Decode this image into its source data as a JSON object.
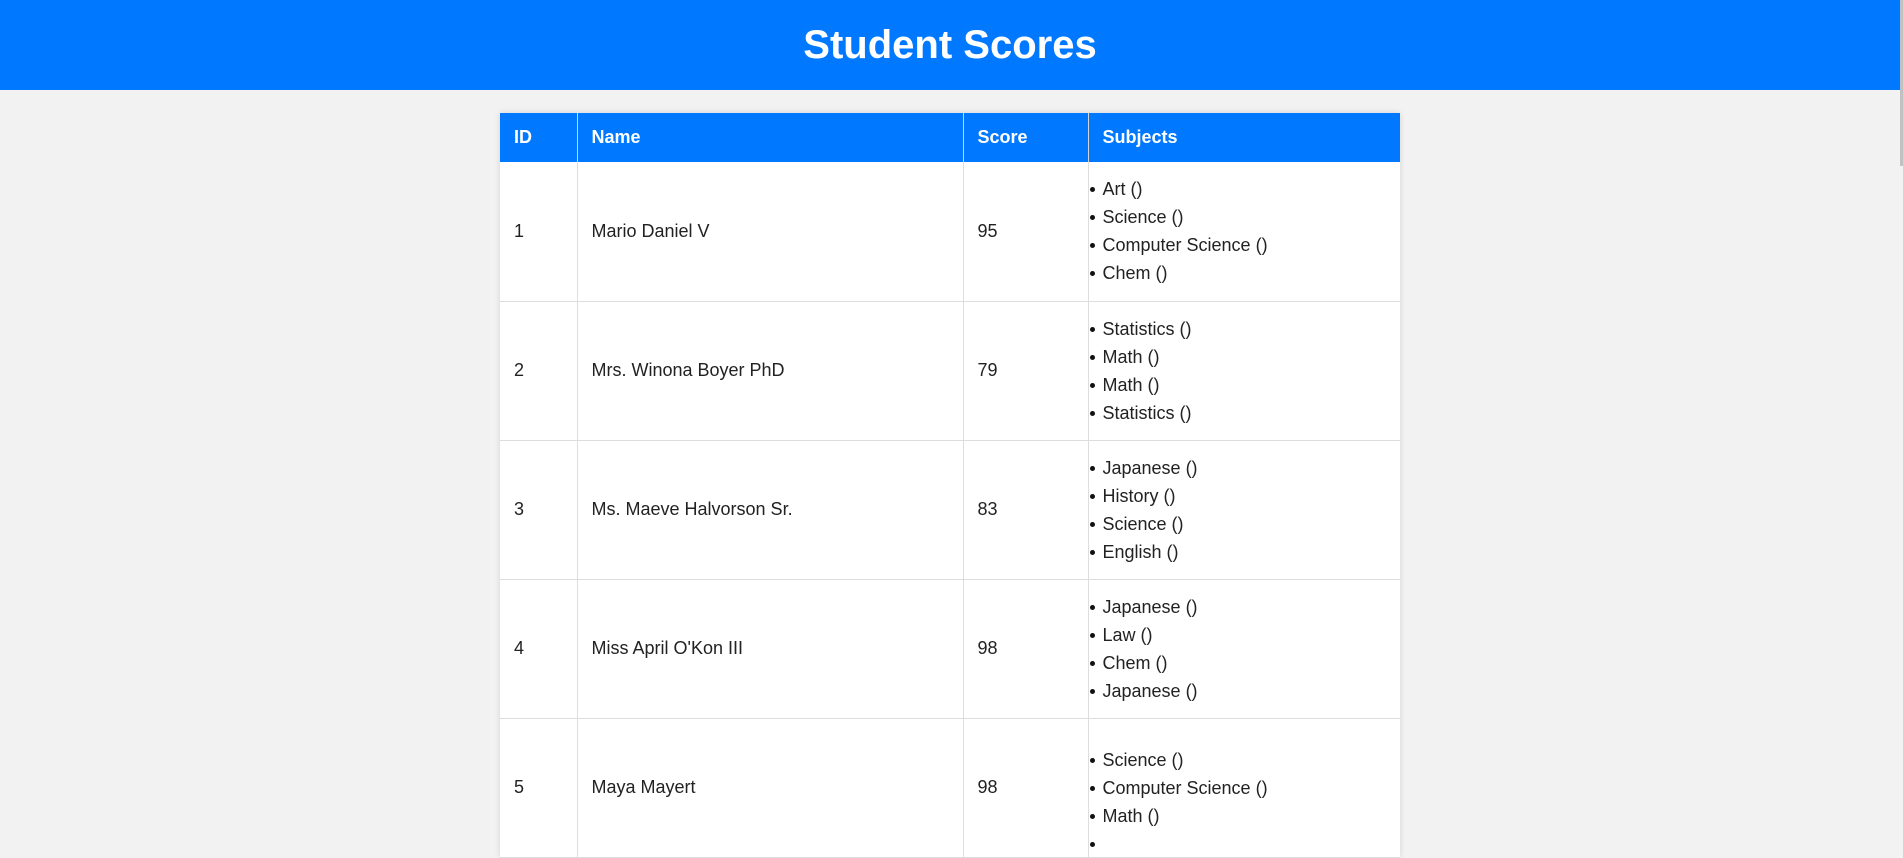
{
  "header": {
    "title": "Student Scores"
  },
  "table": {
    "columns": [
      "ID",
      "Name",
      "Score",
      "Subjects"
    ],
    "rows": [
      {
        "id": "1",
        "name": "Mario Daniel V",
        "score": "95",
        "subjects": [
          "Art ()",
          "Science ()",
          "Computer Science ()",
          "Chem ()"
        ]
      },
      {
        "id": "2",
        "name": "Mrs. Winona Boyer PhD",
        "score": "79",
        "subjects": [
          "Statistics ()",
          "Math ()",
          "Math ()",
          "Statistics ()"
        ]
      },
      {
        "id": "3",
        "name": "Ms. Maeve Halvorson Sr.",
        "score": "83",
        "subjects": [
          "Japanese ()",
          "History ()",
          "Science ()",
          "English ()"
        ]
      },
      {
        "id": "4",
        "name": "Miss April O'Kon III",
        "score": "98",
        "subjects": [
          "Japanese ()",
          "Law ()",
          "Chem ()",
          "Japanese ()"
        ]
      },
      {
        "id": "5",
        "name": "Maya Mayert",
        "score": "98",
        "subjects": [
          "Science ()",
          "Computer Science ()",
          "Math ()",
          ""
        ]
      }
    ]
  },
  "colors": {
    "accent": "#0078ff",
    "background": "#f2f2f2"
  }
}
